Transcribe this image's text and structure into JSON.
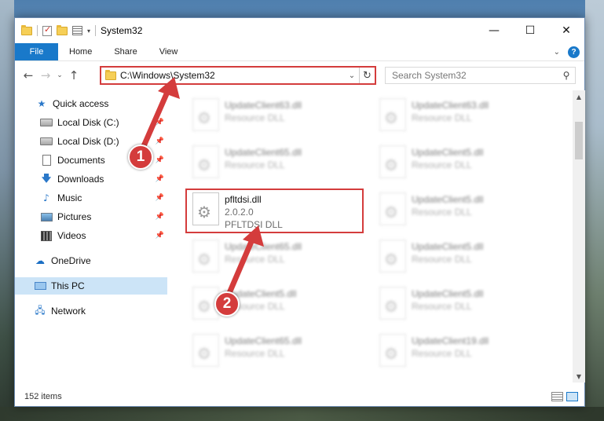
{
  "window": {
    "title": "System32",
    "controls": {
      "minimize": "—",
      "maximize": "☐",
      "close": "✕"
    }
  },
  "ribbon": {
    "tabs": [
      "File",
      "Home",
      "Share",
      "View"
    ],
    "help": "?"
  },
  "address": {
    "path": "C:\\Windows\\System32",
    "search_placeholder": "Search System32"
  },
  "nav": {
    "items": [
      {
        "label": "Quick access",
        "icon": "star-icon",
        "pinned": false
      },
      {
        "label": "Local Disk (C:)",
        "icon": "disk-icon",
        "pinned": true
      },
      {
        "label": "Local Disk (D:)",
        "icon": "disk-icon",
        "pinned": true
      },
      {
        "label": "Documents",
        "icon": "documents-icon",
        "pinned": true
      },
      {
        "label": "Downloads",
        "icon": "download-icon",
        "pinned": true
      },
      {
        "label": "Music",
        "icon": "music-icon",
        "pinned": true
      },
      {
        "label": "Pictures",
        "icon": "pictures-icon",
        "pinned": true
      },
      {
        "label": "Videos",
        "icon": "videos-icon",
        "pinned": true
      },
      {
        "label": "OneDrive",
        "icon": "cloud-icon",
        "pinned": false
      },
      {
        "label": "This PC",
        "icon": "computer-icon",
        "pinned": false,
        "selected": true
      },
      {
        "label": "Network",
        "icon": "network-icon",
        "pinned": false
      }
    ]
  },
  "files": {
    "highlighted": {
      "name": "pfltdsi.dll",
      "version": "2.0.2.0",
      "description": "PFLTDSI DLL"
    },
    "left_column": [
      {
        "name": "UpdateClient63.dll",
        "description": "Resource DLL"
      },
      {
        "name": "UpdateClient65.dll",
        "description": "Resource DLL"
      },
      {
        "name": "UpdateClient65.dll",
        "description": "Resource DLL"
      },
      {
        "name": "UpdateClient5.dll",
        "description": "Resource DLL"
      },
      {
        "name": "UpdateClient65.dll",
        "description": "Resource DLL"
      }
    ],
    "right_column": [
      {
        "name": "UpdateClient63.dll",
        "description": "Resource DLL"
      },
      {
        "name": "UpdateClient5.dll",
        "description": "Resource DLL"
      },
      {
        "name": "UpdateClient5.dll",
        "description": "Resource DLL"
      },
      {
        "name": "UpdateClient5.dll",
        "description": "Resource DLL"
      },
      {
        "name": "UpdateClient5.dll",
        "description": "Resource DLL"
      },
      {
        "name": "UpdateClient19.dll",
        "description": "Resource DLL"
      }
    ]
  },
  "status": {
    "item_count": "152 items"
  },
  "annotations": {
    "step1": "1",
    "step2": "2",
    "color": "#d43c3c"
  }
}
